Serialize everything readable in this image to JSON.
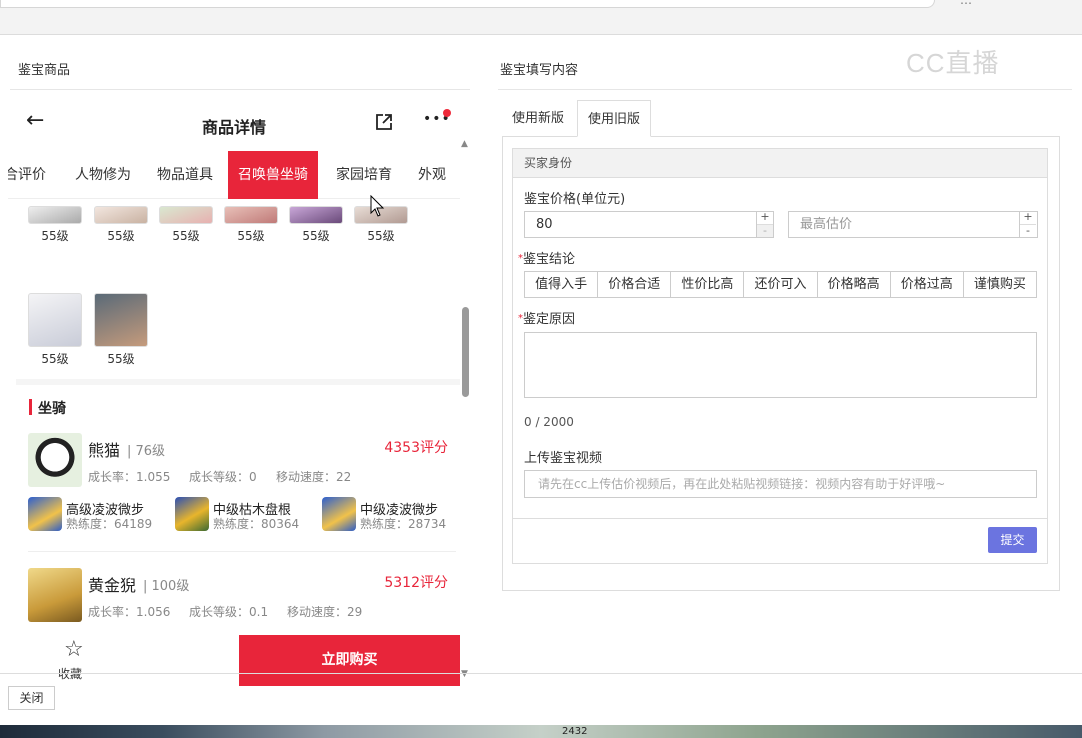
{
  "left_panel": {
    "title": "鉴宝商品"
  },
  "right_panel": {
    "title": "鉴宝填写内容"
  },
  "watermark": "CC直播",
  "product": {
    "nav_title": "商品详情",
    "tabs": [
      "综合评价",
      "人物修为",
      "物品道具",
      "召唤兽坐骑",
      "家园培育",
      "外观"
    ],
    "active_tab": "召唤兽坐骑",
    "pets_row1_levels": [
      "55级",
      "55级",
      "55级",
      "55级",
      "55级",
      "55级"
    ],
    "pets_row2_levels": [
      "55级",
      "55级"
    ],
    "mount_section_title": "坐骑",
    "mounts": [
      {
        "name": "熊猫",
        "level": "| 76级",
        "score": "4353评分",
        "stats": [
          "成长率：1.055",
          "成长等级：0",
          "移动速度：22"
        ],
        "skills": [
          {
            "name": "高级凌波微步",
            "prof": "熟练度：64189"
          },
          {
            "name": "中级枯木盘根",
            "prof": "熟练度：80364"
          },
          {
            "name": "中级凌波微步",
            "prof": "熟练度：28734"
          }
        ]
      },
      {
        "name": "黄金猊",
        "level": "| 100级",
        "score": "5312评分",
        "stats": [
          "成长率：1.056",
          "成长等级：0.1",
          "移动速度：29"
        ]
      }
    ],
    "favorite_label": "收藏",
    "buy_label": "立即购买"
  },
  "form": {
    "tabs": [
      "使用新版",
      "使用旧版"
    ],
    "active_tab": "使用旧版",
    "card_title": "买家身份",
    "price_label": "鉴宝价格(单位元)",
    "price_value": "80",
    "max_price_placeholder": "最高估价",
    "stepper_plus": "+",
    "stepper_minus": "-",
    "required_mark": "*",
    "conclusion_label": "鉴宝结论",
    "conclusion_options": [
      "值得入手",
      "价格合适",
      "性价比高",
      "还价可入",
      "价格略高",
      "价格过高",
      "谨慎购买"
    ],
    "reason_label": "鉴定原因",
    "reason_counter": "0 / 2000",
    "video_label": "上传鉴宝视频",
    "video_placeholder": "请先在cc上传估价视频后，再在此处粘贴视频链接：视频内容有助于好评哦~",
    "submit_label": "提交"
  },
  "footer": {
    "close_label": "关闭"
  },
  "taskbar": {
    "number": "2432"
  },
  "colors": {
    "accent_red": "#e8253a",
    "submit_blue": "#6b74e0"
  }
}
